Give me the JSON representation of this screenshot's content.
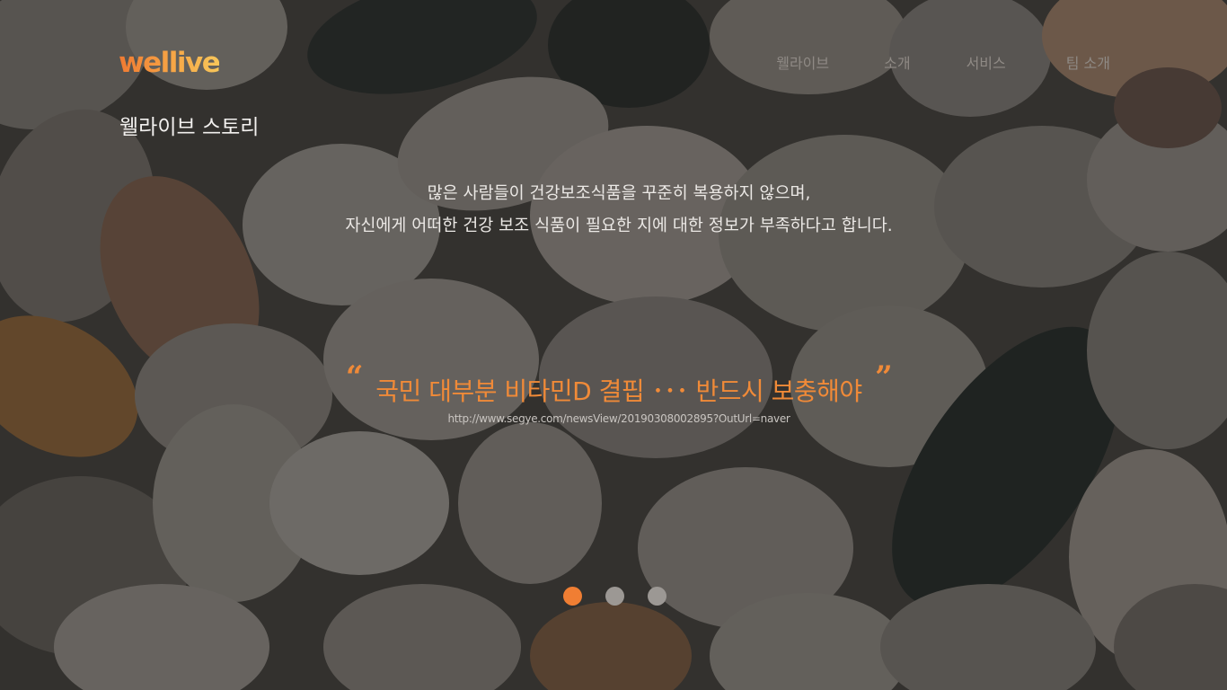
{
  "brand": {
    "logo_text": "wellive",
    "accent_color": "#f07e33"
  },
  "nav": {
    "items": [
      {
        "label": "웰라이브"
      },
      {
        "label": "소개"
      },
      {
        "label": "서비스"
      },
      {
        "label": "팀 소개"
      }
    ]
  },
  "section": {
    "title": "웰라이브 스토리"
  },
  "intro": {
    "line1": "많은 사람들이 건강보조식품을 꾸준히 복용하지 않으며,",
    "line2": "자신에게 어떠한 건강 보조 식품이 필요한 지에 대한 정보가 부족하다고 합니다."
  },
  "quote": {
    "open_mark": "“",
    "text": "국민 대부분 비타민D 결핍 ･･･ 반드시 보충해야",
    "close_mark": "”",
    "source_url": "http://www.segye.com/newsView/20190308002895?OutUrl=naver"
  },
  "carousel": {
    "slide_count": 3,
    "active_index": 0,
    "active_color": "#f07e33",
    "inactive_color": "#9c9894"
  },
  "background": {
    "description_icon": "pills-photo-background"
  }
}
